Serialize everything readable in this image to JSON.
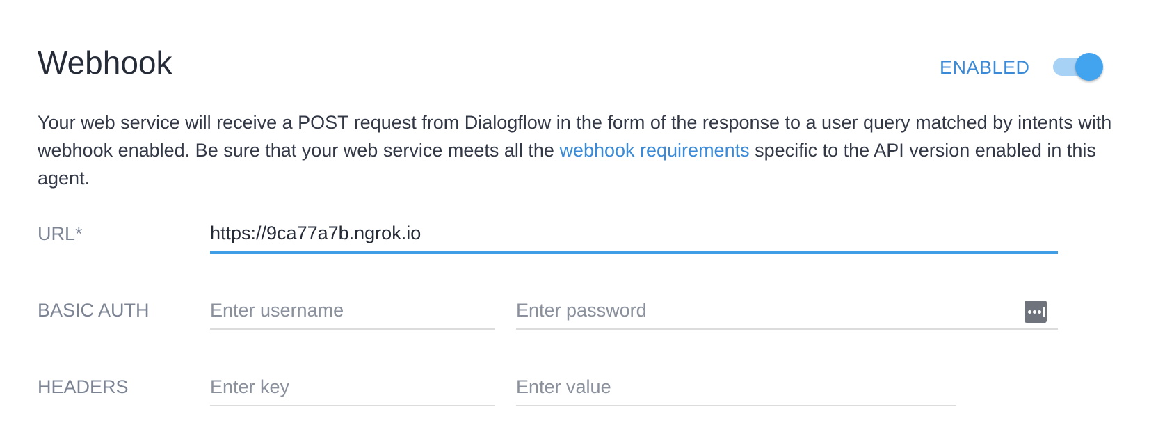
{
  "header": {
    "title": "Webhook",
    "status_label": "ENABLED",
    "toggle_on": true
  },
  "description": {
    "text_before": "Your web service will receive a POST request from Dialogflow in the form of the response to a user query matched by intents with webhook enabled. Be sure that your web service meets all the ",
    "link_text": "webhook requirements",
    "text_after": " specific to the API version enabled in this agent."
  },
  "url": {
    "label": "URL*",
    "value": "https://9ca77a7b.ngrok.io"
  },
  "basic_auth": {
    "label": "BASIC AUTH",
    "username_placeholder": "Enter username",
    "password_placeholder": "Enter password",
    "password_icon": "password-manager-icon"
  },
  "headers": {
    "label": "HEADERS",
    "key_placeholder": "Enter key",
    "value_placeholder": "Enter value"
  },
  "colors": {
    "accent": "#3a8ad8",
    "toggle_thumb": "#42a3ef",
    "toggle_track": "#a7d1f5",
    "active_underline": "#3f9ee6"
  }
}
